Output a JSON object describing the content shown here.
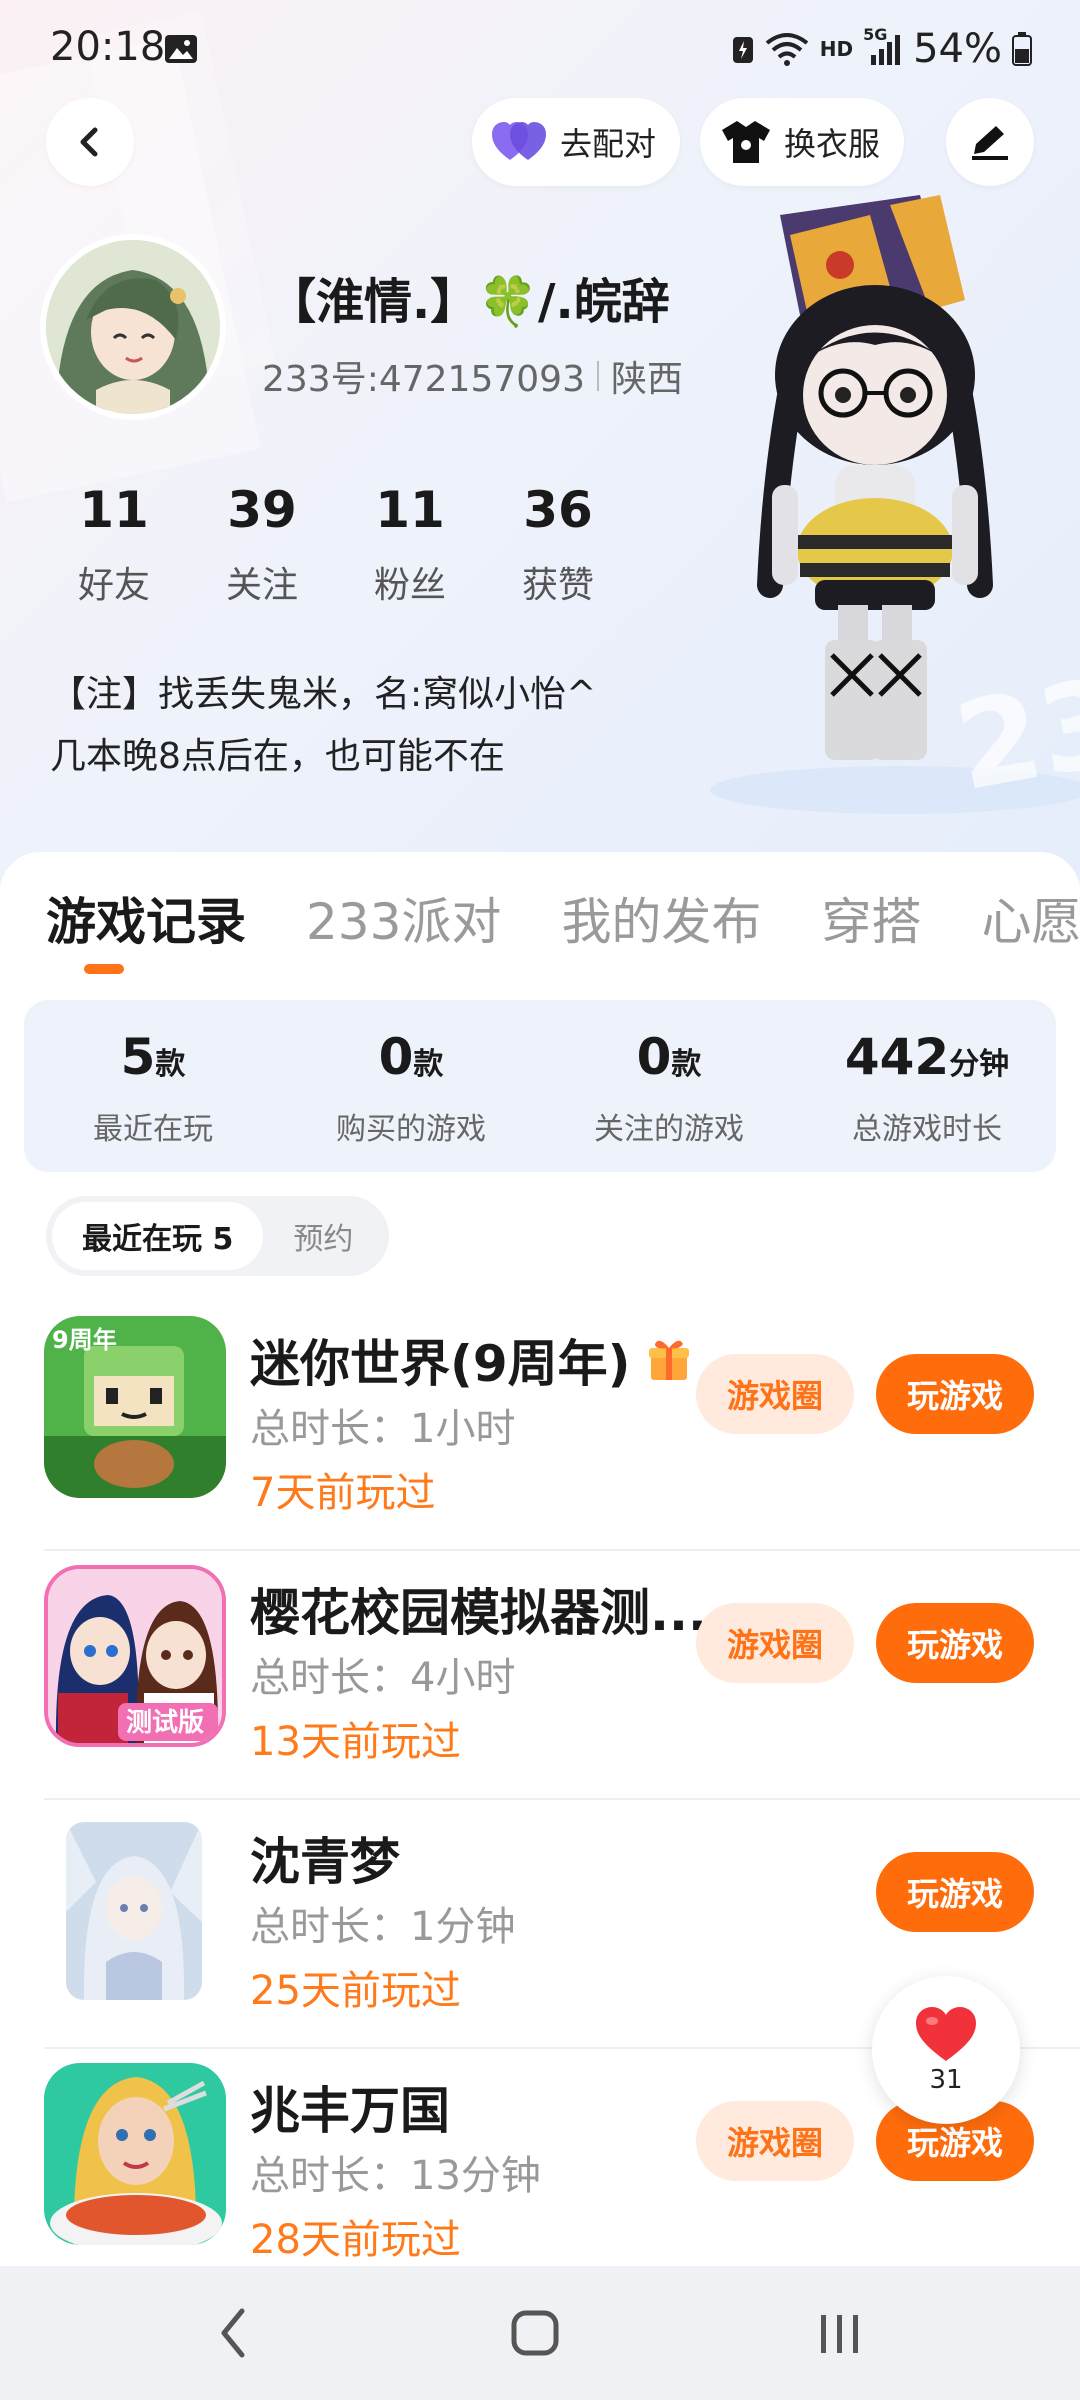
{
  "status_bar": {
    "time": "20:18",
    "network": "HD",
    "signal_label": "5G",
    "battery": "54%"
  },
  "header": {
    "match_label": "去配对",
    "dress_label": "换衣服"
  },
  "profile": {
    "nickname": "【淮情.】🍀/.皖辞",
    "uid": "233号:472157093",
    "region": "陕西",
    "stats": [
      {
        "value": "11",
        "label": "好友"
      },
      {
        "value": "39",
        "label": "关注"
      },
      {
        "value": "11",
        "label": "粉丝"
      },
      {
        "value": "36",
        "label": "获赞"
      }
    ],
    "bio_line1": "【注】找丢失鬼米，名:窝似小怡^",
    "bio_line2": "几本晚8点后在，也可能不在"
  },
  "tabs": [
    "游戏记录",
    "233派对",
    "我的发布",
    "穿搭",
    "心愿"
  ],
  "summary": [
    {
      "value": "5",
      "unit": "款",
      "label": "最近在玩"
    },
    {
      "value": "0",
      "unit": "款",
      "label": "购买的游戏"
    },
    {
      "value": "0",
      "unit": "款",
      "label": "关注的游戏"
    },
    {
      "value": "442",
      "unit": "分钟",
      "label": "总游戏时长"
    }
  ],
  "segments": {
    "recent": "最近在玩 5",
    "reserve": "预约"
  },
  "games": [
    {
      "name": "迷你世界(9周年)",
      "duration": "总时长：1小时",
      "last_played": "7天前玩过",
      "circle_label": "游戏圈",
      "play_label": "玩游戏"
    },
    {
      "name": "樱花校园模拟器测...",
      "duration": "总时长：4小时",
      "last_played": "13天前玩过",
      "circle_label": "游戏圈",
      "play_label": "玩游戏"
    },
    {
      "name": "沈青梦",
      "duration": "总时长：1分钟",
      "last_played": "25天前玩过",
      "play_label": "玩游戏"
    },
    {
      "name": "兆丰万国",
      "duration": "总时长：13分钟",
      "last_played": "28天前玩过",
      "circle_label": "游戏圈",
      "play_label": "玩游戏"
    }
  ],
  "icon_texts": {
    "mini_badge": "9周年",
    "sakura_badge": "测试版"
  },
  "like": {
    "count": "31"
  },
  "colors": {
    "accent": "#ff6c0c",
    "accent_light": "#ffeadd",
    "last_played": "#ff7a1a"
  }
}
